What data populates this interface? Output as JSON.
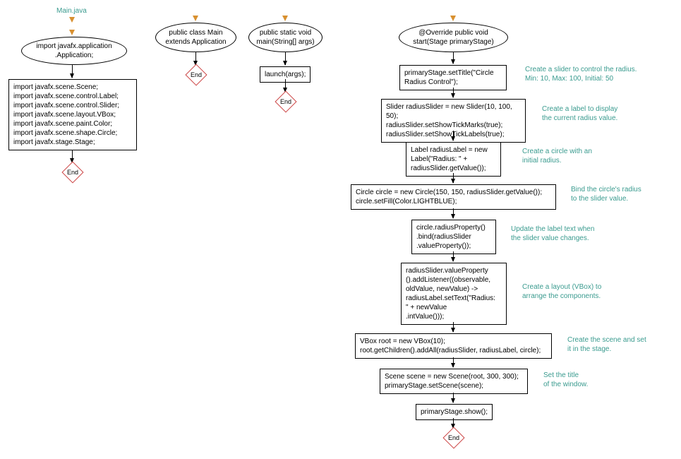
{
  "title": "Main.java",
  "columns": {
    "import": {
      "ellipse": "import javafx.application\n.Application;",
      "box": "import javafx.scene.Scene;\nimport javafx.scene.control.Label;\nimport javafx.scene.control.Slider;\nimport javafx.scene.layout.VBox;\nimport javafx.scene.paint.Color;\nimport javafx.scene.shape.Circle;\nimport javafx.stage.Stage;"
    },
    "class": {
      "ellipse": "public class Main\nextends Application"
    },
    "main": {
      "ellipse": "public static void\nmain(String[] args)",
      "box": "launch(args);"
    },
    "start": {
      "ellipse": "@Override public void\nstart(Stage primaryStage)",
      "boxes": [
        "primaryStage.setTitle(\"Circle\nRadius Control\");",
        "Slider radiusSlider = new Slider(10, 100, 50);\nradiusSlider.setShowTickMarks(true);\nradiusSlider.setShowTickLabels(true);",
        "Label radiusLabel = new\nLabel(\"Radius: \" +\nradiusSlider.getValue());",
        "Circle circle = new Circle(150, 150, radiusSlider.getValue());\ncircle.setFill(Color.LIGHTBLUE);",
        "circle.radiusProperty()\n.bind(radiusSlider\n.valueProperty());",
        "radiusSlider.valueProperty\n().addListener((observable,\noldValue, newValue) ->\nradiusLabel.setText(\"Radius:\n\" + newValue\n.intValue()));",
        "VBox root = new VBox(10);\nroot.getChildren().addAll(radiusSlider, radiusLabel, circle);",
        "Scene scene = new Scene(root, 300, 300);\nprimaryStage.setScene(scene);",
        "primaryStage.show();"
      ],
      "annotations": [
        "Create a slider to control the radius.\nMin: 10, Max: 100, Initial: 50",
        "Create a label to display\nthe current radius value.",
        "Create a circle with an\ninitial radius.",
        "Bind the circle's radius\nto the slider value.",
        "Update the label text when\nthe slider value changes.",
        "Create a layout (VBox) to\narrange the components.",
        "Create the scene and set\nit in the stage.",
        "Set the title\nof the window."
      ]
    }
  },
  "end_label": "End"
}
